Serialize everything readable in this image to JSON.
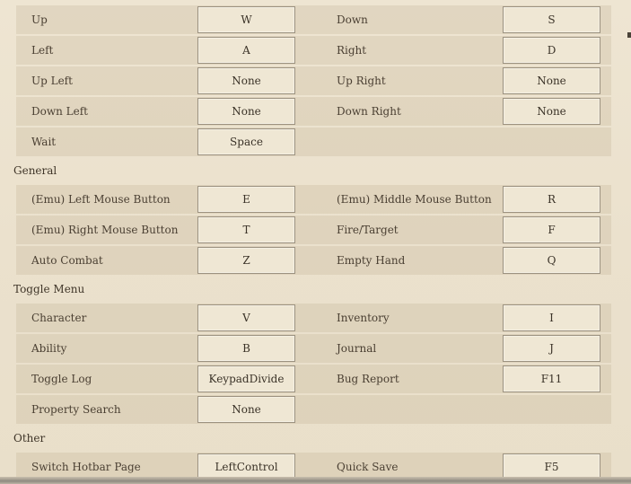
{
  "rows_movement": [
    {
      "left_label": "Up",
      "left_key": "W",
      "right_label": "Down",
      "right_key": "S"
    },
    {
      "left_label": "Left",
      "left_key": "A",
      "right_label": "Right",
      "right_key": "D"
    },
    {
      "left_label": "Up Left",
      "left_key": "None",
      "right_label": "Up Right",
      "right_key": "None"
    },
    {
      "left_label": "Down Left",
      "left_key": "None",
      "right_label": "Down Right",
      "right_key": "None"
    },
    {
      "left_label": "Wait",
      "left_key": "Space"
    }
  ],
  "sections": {
    "general": "General",
    "toggle_menu": "Toggle Menu",
    "other": "Other"
  },
  "rows_general": [
    {
      "left_label": "(Emu) Left Mouse Button",
      "left_key": "E",
      "right_label": "(Emu) Middle Mouse Button",
      "right_key": "R"
    },
    {
      "left_label": "(Emu) Right Mouse Button",
      "left_key": "T",
      "right_label": "Fire/Target",
      "right_key": "F"
    },
    {
      "left_label": "Auto Combat",
      "left_key": "Z",
      "right_label": "Empty Hand",
      "right_key": "Q"
    }
  ],
  "rows_toggle": [
    {
      "left_label": "Character",
      "left_key": "V",
      "right_label": "Inventory",
      "right_key": "I"
    },
    {
      "left_label": "Ability",
      "left_key": "B",
      "right_label": "Journal",
      "right_key": "J"
    },
    {
      "left_label": "Toggle Log",
      "left_key": "KeypadDivide",
      "right_label": "Bug Report",
      "right_key": "F11"
    },
    {
      "left_label": "Property Search",
      "left_key": "None"
    }
  ],
  "rows_other": [
    {
      "left_label": "Switch Hotbar Page",
      "left_key": "LeftControl",
      "right_label": "Quick Save",
      "right_key": "F5"
    }
  ]
}
